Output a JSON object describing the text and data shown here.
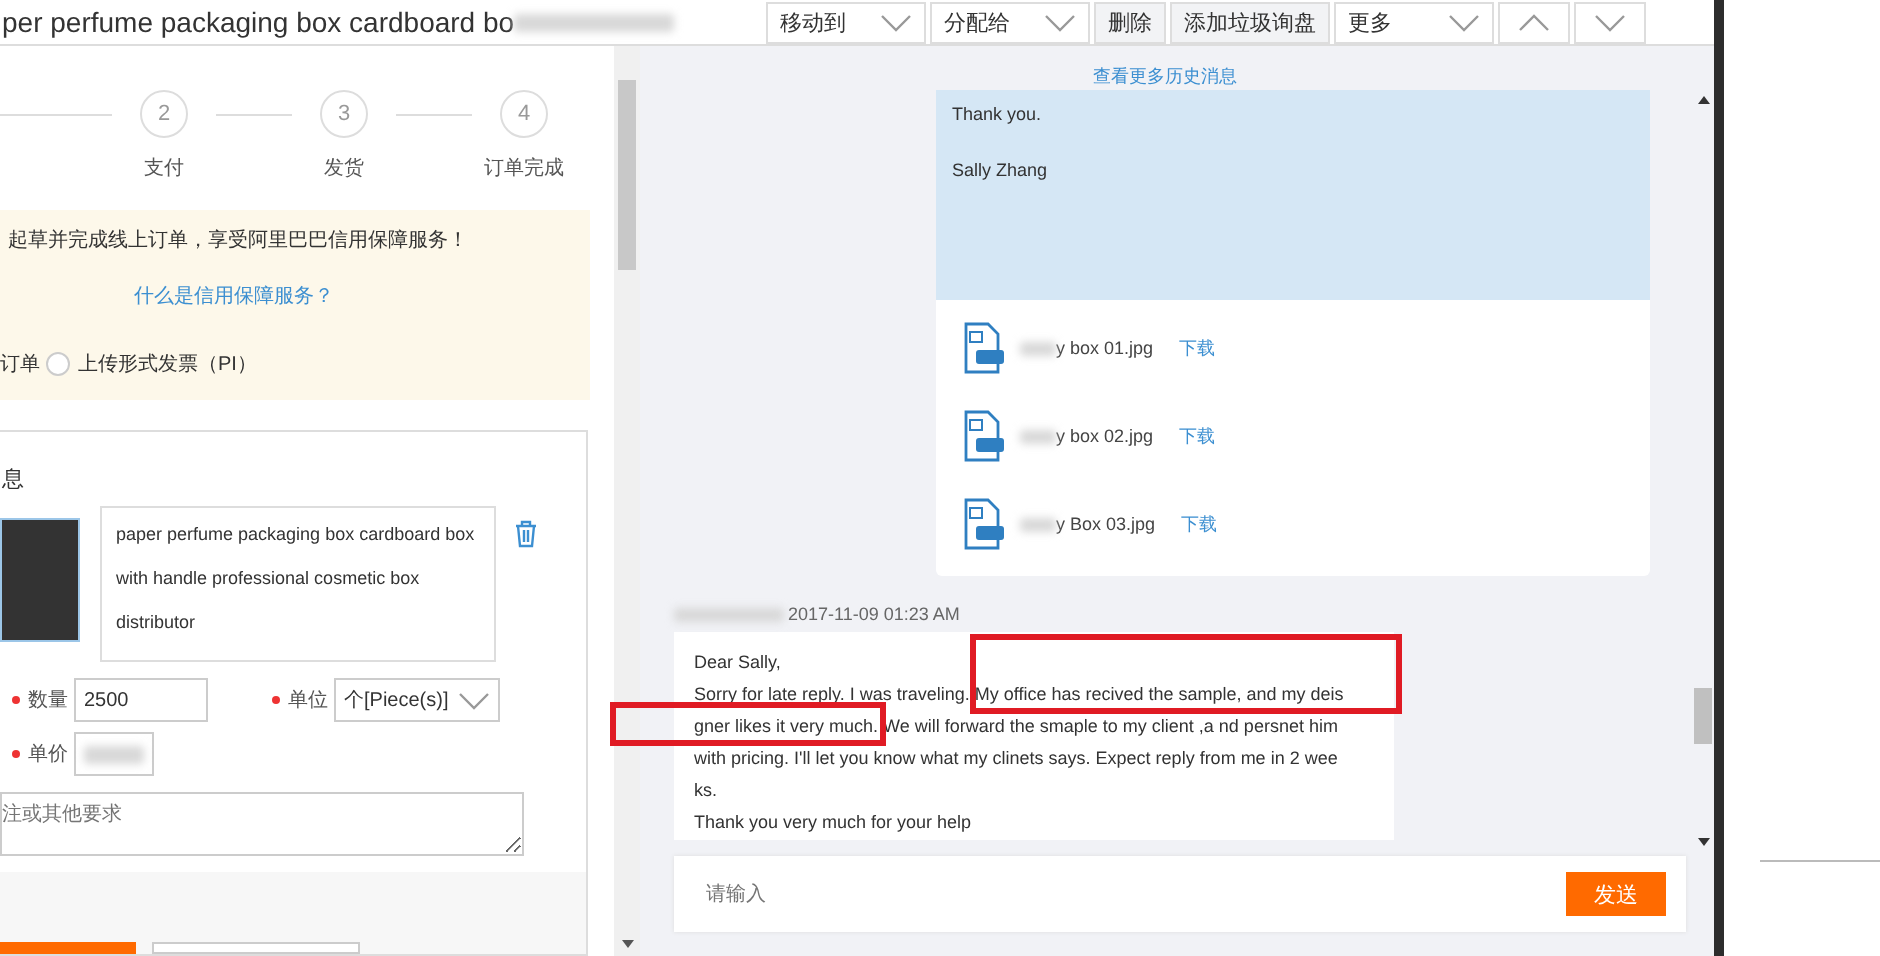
{
  "title": {
    "text": "per perfume packaging box cardboard bo",
    "redacted_tail": true
  },
  "toolbar": [
    {
      "kind": "dropdown",
      "label": "移动到"
    },
    {
      "kind": "dropdown",
      "label": "分配给"
    },
    {
      "kind": "button",
      "label": "删除"
    },
    {
      "kind": "button",
      "label": "添加垃圾询盘"
    },
    {
      "kind": "dropdown",
      "label": "更多"
    },
    {
      "kind": "arrow-up"
    },
    {
      "kind": "arrow-down"
    }
  ],
  "steps": [
    {
      "number": "2",
      "label": "支付"
    },
    {
      "number": "3",
      "label": "发货"
    },
    {
      "number": "4",
      "label": "订单完成"
    }
  ],
  "notice": {
    "text": "起草并完成线上订单，享受阿里巴巴信用保障服务！",
    "link": "什么是信用保障服务？",
    "order_fragment": "订单",
    "radios": [
      {
        "label": "上传形式发票（PI）",
        "selected": false
      }
    ]
  },
  "product": {
    "section_title_fragment": "息",
    "description": "paper perfume packaging box cardboard box with handle professional cosmetic box distributor",
    "fields": [
      {
        "kind": "input",
        "label": "数量",
        "required": true,
        "value": "2500"
      },
      {
        "kind": "select",
        "label": "单位",
        "required": true,
        "value": "个[Piece(s)]"
      },
      {
        "kind": "redacted-input",
        "label": "单价",
        "required": true
      }
    ],
    "remarks_placeholder": "注或其他要求",
    "footer_buttons": [
      {
        "kind": "primary"
      },
      {
        "kind": "secondary"
      }
    ]
  },
  "chat": {
    "history_link": "查看更多历史消息",
    "messages": [
      {
        "kind": "outgoing",
        "paragraphs": [
          "Thank you.",
          "Sally Zhang"
        ],
        "attachments": [
          {
            "name": "y box 01.jpg",
            "action": "下载"
          },
          {
            "name": "y box 02.jpg",
            "action": "下载"
          },
          {
            "name": "y Box 03.jpg",
            "action": "下载"
          }
        ]
      },
      {
        "kind": "incoming",
        "sender_redacted": true,
        "time": "2017-11-09 01:23 AM",
        "lines": [
          "Dear Sally,",
          "Sorry for late reply. I was traveling. My office has recived the sample, and my deis",
          "gner likes it very much. We will forward the smaple to my client ,a nd persnet him",
          "with pricing. I'll let you know what my clinets says. Expect reply from me in 2 wee",
          "ks.",
          "Thank you very much for your help"
        ]
      }
    ],
    "composer": {
      "placeholder": "请输入",
      "send": "发送"
    }
  },
  "annotation_boxes": [
    {
      "kind": "highlight",
      "color": "#e01b24"
    },
    {
      "kind": "highlight",
      "color": "#e01b24"
    }
  ]
}
